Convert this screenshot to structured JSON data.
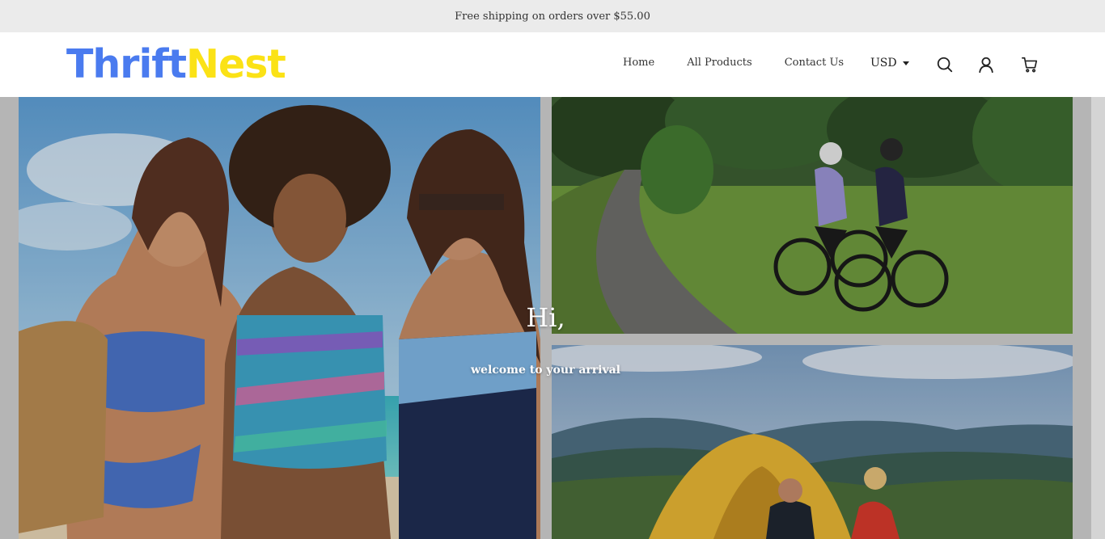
{
  "announcement": {
    "text": "Free shipping on orders over $55.00"
  },
  "brand": {
    "part1": "Thrift",
    "part2": "Nest",
    "color1": "#4a7bef",
    "color2": "#fbe216"
  },
  "nav": {
    "items": [
      {
        "label": "Home"
      },
      {
        "label": "All Products"
      },
      {
        "label": "Contact Us"
      }
    ]
  },
  "currency": {
    "selected": "USD"
  },
  "icons": {
    "search": "search-icon",
    "account": "user-icon",
    "cart": "cart-icon"
  },
  "hero": {
    "heading": "Hi,",
    "subheading": "welcome to your arrival",
    "images": [
      {
        "name": "swimwear-image"
      },
      {
        "name": "cycling-image"
      },
      {
        "name": "camping-image"
      }
    ]
  }
}
